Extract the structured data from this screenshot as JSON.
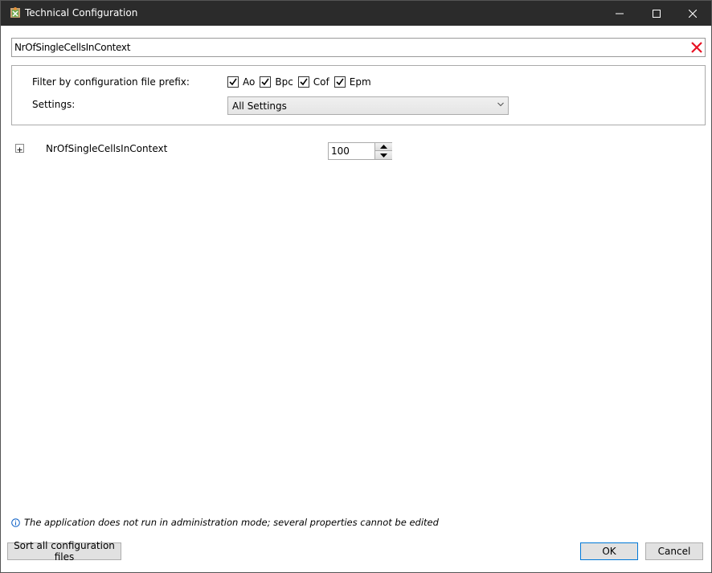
{
  "window": {
    "title": "Technical Configuration"
  },
  "search": {
    "value": "NrOfSingleCellsInContext"
  },
  "filter": {
    "prefix_label": "Filter by configuration file prefix:",
    "checkboxes": [
      {
        "label": "Ao",
        "checked": true
      },
      {
        "label": "Bpc",
        "checked": true
      },
      {
        "label": "Cof",
        "checked": true
      },
      {
        "label": "Epm",
        "checked": true
      }
    ],
    "settings_label": "Settings:",
    "settings_selected": "All Settings"
  },
  "properties": [
    {
      "name": "NrOfSingleCellsInContext",
      "value": "100"
    }
  ],
  "info": {
    "text": "The application does not run in administration mode; several properties cannot be edited"
  },
  "buttons": {
    "sort": "Sort all configuration files",
    "ok": "OK",
    "cancel": "Cancel"
  },
  "colors": {
    "titlebar": "#2b2b2b",
    "clear_icon": "#e81123",
    "accent": "#0078d7"
  }
}
